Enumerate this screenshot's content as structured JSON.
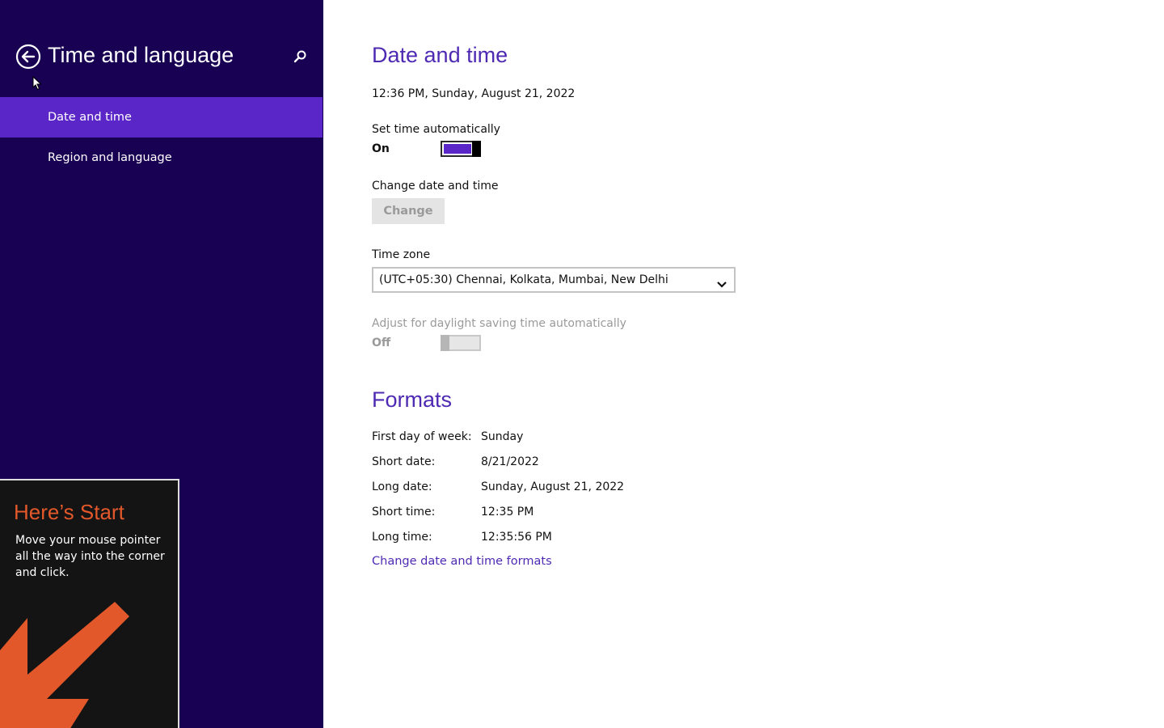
{
  "sidebar": {
    "title": "Time and language",
    "back_icon": "back-arrow-circle-icon",
    "search_icon": "search-icon",
    "items": [
      {
        "label": "Date and time",
        "active": true
      },
      {
        "label": "Region and language",
        "active": false
      }
    ]
  },
  "tip": {
    "title": "Here’s Start",
    "text": "Move your mouse pointer all the way into the corner and click.",
    "arrow_icon": "arrow-down-left-icon"
  },
  "date_time": {
    "heading": "Date and time",
    "current": "12:36 PM, Sunday, August 21, 2022",
    "set_auto_label": "Set time automatically",
    "set_auto_state": "On",
    "change_label": "Change date and time",
    "change_button": "Change",
    "timezone_label": "Time zone",
    "timezone_value": "(UTC+05:30) Chennai, Kolkata, Mumbai, New Delhi",
    "dst_label": "Adjust for daylight saving time automatically",
    "dst_state": "Off"
  },
  "formats": {
    "heading": "Formats",
    "rows": [
      {
        "label": "First day of week:",
        "value": "Sunday"
      },
      {
        "label": "Short date:",
        "value": "8/21/2022"
      },
      {
        "label": "Long date:",
        "value": "Sunday, August 21, 2022"
      },
      {
        "label": "Short time:",
        "value": "12:35 PM"
      },
      {
        "label": "Long time:",
        "value": "12:35:56 PM"
      }
    ],
    "link": "Change date and time formats"
  },
  "colors": {
    "sidebar_bg": "#180052",
    "accent": "#5b26c8",
    "heading": "#4e2ab3",
    "tip_accent": "#e2582a"
  }
}
